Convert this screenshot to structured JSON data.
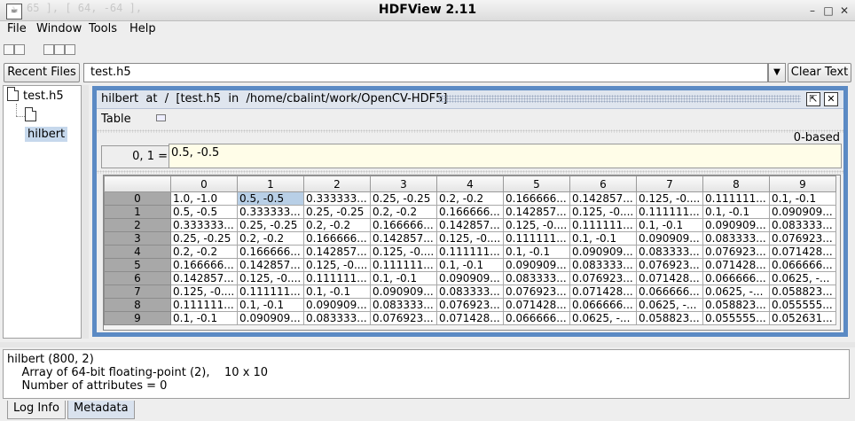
{
  "window": {
    "title": "HDFView 2.11",
    "ghost_text": "65 ], [ 64, -64 ],",
    "min": "–",
    "max": "□",
    "close": "✕"
  },
  "menu": [
    "File",
    "Window",
    "Tools",
    "Help"
  ],
  "pathbar": {
    "recent_label": "Recent Files",
    "path": "test.h5",
    "clear_label": "Clear Text"
  },
  "tree": {
    "root": "test.h5",
    "child": "hilbert"
  },
  "dataset": {
    "title": "hilbert  at  /  [test.h5  in  /home/cbalint/work/OpenCV-HDF5]",
    "table_menu": "Table",
    "index_base": "0-based",
    "cell_position": "0, 1  =",
    "cell_value": "0.5, -0.5",
    "columns": [
      "",
      "0",
      "1",
      "2",
      "3",
      "4",
      "5",
      "6",
      "7",
      "8",
      "9"
    ],
    "rows": [
      [
        "0",
        "1.0, -1.0",
        "0.5, -0.5",
        "0.333333...",
        "0.25, -0.25",
        "0.2, -0.2",
        "0.166666...",
        "0.142857...",
        "0.125, -0....",
        "0.111111...",
        "0.1, -0.1"
      ],
      [
        "1",
        "0.5, -0.5",
        "0.333333...",
        "0.25, -0.25",
        "0.2, -0.2",
        "0.166666...",
        "0.142857...",
        "0.125, -0....",
        "0.111111...",
        "0.1, -0.1",
        "0.090909..."
      ],
      [
        "2",
        "0.333333...",
        "0.25, -0.25",
        "0.2, -0.2",
        "0.166666...",
        "0.142857...",
        "0.125, -0....",
        "0.111111...",
        "0.1, -0.1",
        "0.090909...",
        "0.083333..."
      ],
      [
        "3",
        "0.25, -0.25",
        "0.2, -0.2",
        "0.166666...",
        "0.142857...",
        "0.125, -0....",
        "0.111111...",
        "0.1, -0.1",
        "0.090909...",
        "0.083333...",
        "0.076923..."
      ],
      [
        "4",
        "0.2, -0.2",
        "0.166666...",
        "0.142857...",
        "0.125, -0....",
        "0.111111...",
        "0.1, -0.1",
        "0.090909...",
        "0.083333...",
        "0.076923...",
        "0.071428..."
      ],
      [
        "5",
        "0.166666...",
        "0.142857...",
        "0.125, -0....",
        "0.111111...",
        "0.1, -0.1",
        "0.090909...",
        "0.083333...",
        "0.076923...",
        "0.071428...",
        "0.066666..."
      ],
      [
        "6",
        "0.142857...",
        "0.125, -0....",
        "0.111111...",
        "0.1, -0.1",
        "0.090909...",
        "0.083333...",
        "0.076923...",
        "0.071428...",
        "0.066666...",
        "0.0625, -..."
      ],
      [
        "7",
        "0.125, -0....",
        "0.111111...",
        "0.1, -0.1",
        "0.090909...",
        "0.083333...",
        "0.076923...",
        "0.071428...",
        "0.066666...",
        "0.0625, -...",
        "0.058823..."
      ],
      [
        "8",
        "0.111111...",
        "0.1, -0.1",
        "0.090909...",
        "0.083333...",
        "0.076923...",
        "0.071428...",
        "0.066666...",
        "0.0625, -...",
        "0.058823...",
        "0.055555..."
      ],
      [
        "9",
        "0.1, -0.1",
        "0.090909...",
        "0.083333...",
        "0.076923...",
        "0.071428...",
        "0.066666...",
        "0.0625, -...",
        "0.058823...",
        "0.055555...",
        "0.052631..."
      ]
    ],
    "selected_cell": [
      0,
      1
    ]
  },
  "status": {
    "line1": "hilbert (800, 2)",
    "line2": "    Array of 64-bit floating-point (2),    10 x 10",
    "line3": "    Number of attributes = 0"
  },
  "tabs": {
    "log": "Log Info",
    "metadata": "Metadata"
  }
}
